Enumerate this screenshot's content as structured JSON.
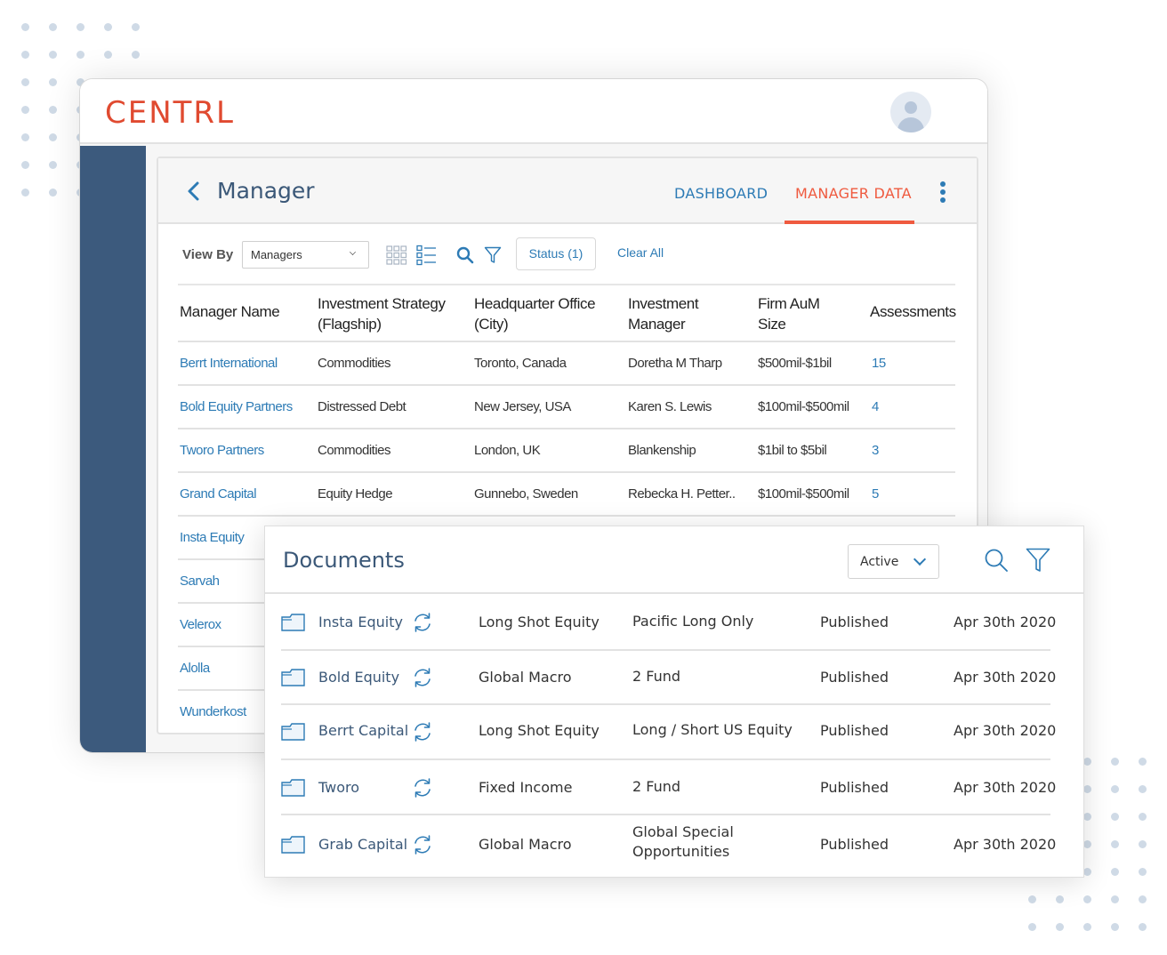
{
  "app": {
    "logo": "CENTRL",
    "user_avatar": "user-avatar"
  },
  "panel": {
    "title": "Manager",
    "tabs": [
      {
        "label": "DASHBOARD",
        "active": false
      },
      {
        "label": "MANAGER DATA",
        "active": true
      }
    ]
  },
  "toolbar": {
    "view_by_label": "View By",
    "view_by_value": "Managers",
    "status_button": "Status (1)",
    "clear_all": "Clear All"
  },
  "manager_table": {
    "headers": [
      "Manager Name",
      "Investment Strategy (Flagship)",
      "Headquarter Office (City)",
      "Investment Manager",
      "Firm AuM Size",
      "Assessments"
    ],
    "rows": [
      {
        "name": "Berrt International",
        "strategy": "Commodities",
        "hq": "Toronto, Canada",
        "manager": "Doretha M Tharp",
        "aum": "$500mil-$1bil",
        "assessments": "15"
      },
      {
        "name": "Bold Equity Partners",
        "strategy": "Distressed Debt",
        "hq": "New Jersey, USA",
        "manager": "Karen S. Lewis",
        "aum": "$100mil-$500mil",
        "assessments": "4"
      },
      {
        "name": "Tworo Partners",
        "strategy": "Commodities",
        "hq": "London, UK",
        "manager": "Blankenship",
        "aum": "$1bil to $5bil",
        "assessments": "3"
      },
      {
        "name": "Grand Capital",
        "strategy": "Equity Hedge",
        "hq": "Gunnebo, Sweden",
        "manager": "Rebecka H. Petter..",
        "aum": "$100mil-$500mil",
        "assessments": "5"
      },
      {
        "name": "Insta Equity"
      },
      {
        "name": "Sarvah"
      },
      {
        "name": "Velerox"
      },
      {
        "name": "Alolla"
      },
      {
        "name": "Wunderkost"
      }
    ]
  },
  "documents": {
    "title": "Documents",
    "filter_value": "Active",
    "rows": [
      {
        "name": "Insta Equity",
        "strategy": "Long Shot Equity",
        "fund": "Pacific Long Only",
        "status": "Published",
        "date": "Apr 30th 2020"
      },
      {
        "name": "Bold Equity",
        "strategy": "Global Macro",
        "fund": "2 Fund",
        "status": "Published",
        "date": "Apr 30th 2020"
      },
      {
        "name": "Berrt Capital",
        "strategy": "Long Shot Equity",
        "fund": "Long / Short US Equity",
        "status": "Published",
        "date": "Apr 30th 2020"
      },
      {
        "name": "Tworo",
        "strategy": "Fixed Income",
        "fund": "2 Fund",
        "status": "Published",
        "date": "Apr 30th 2020"
      },
      {
        "name": "Grab Capital",
        "strategy": "Global Macro",
        "fund_line1": "Global Special",
        "fund_line2": "Opportunities",
        "status": "Published",
        "date": "Apr 30th 2020"
      }
    ]
  },
  "colors": {
    "brand": "#e04a30",
    "accent_blue": "#2d7bb5",
    "active_tab": "#ef5a3f",
    "sidebar": "#3c5a7d",
    "title": "#3b5878"
  }
}
